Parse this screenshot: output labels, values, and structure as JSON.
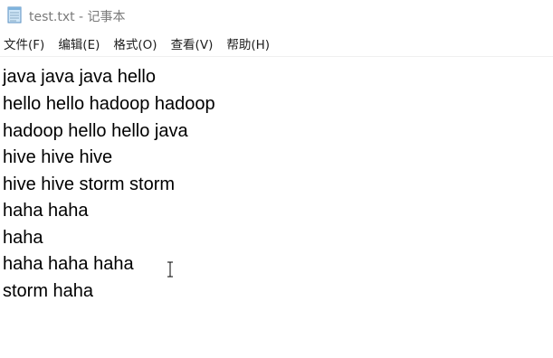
{
  "window": {
    "title": "test.txt - 记事本",
    "icon": "notepad-icon"
  },
  "menu": {
    "items": [
      {
        "label": "文件(F)"
      },
      {
        "label": "编辑(E)"
      },
      {
        "label": "格式(O)"
      },
      {
        "label": "查看(V)"
      },
      {
        "label": "帮助(H)"
      }
    ]
  },
  "editor": {
    "lines": [
      "java java java hello",
      "hello hello hadoop hadoop",
      "hadoop hello hello java",
      "hive hive hive",
      "hive hive storm storm",
      "haha haha",
      "haha",
      "haha haha haha",
      "storm haha"
    ],
    "cursor_icon": "text-ibeam-cursor-icon"
  }
}
